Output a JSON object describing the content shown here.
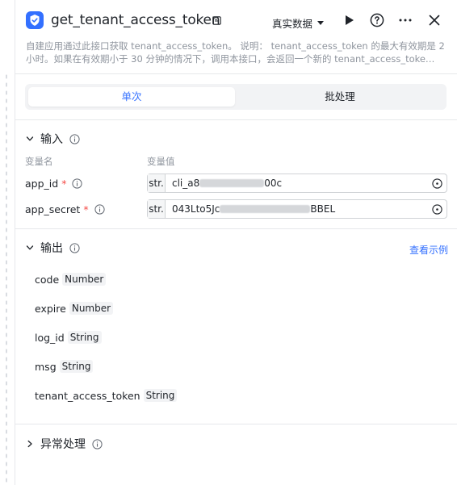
{
  "header": {
    "title": "get_tenant_access_token",
    "mode": "真实数据",
    "description_line1": "自建应用通过此接口获取 tenant_access_token。 说明： tenant_access_token 的最大有效期是 2",
    "description_line2": "小时。如果在有效期小于 30 分钟的情况下，调用本接口，会返回一个新的 tenant_access_toke…"
  },
  "tabs": [
    {
      "label": "单次",
      "active": true
    },
    {
      "label": "批处理",
      "active": false
    }
  ],
  "input": {
    "section_title": "输入",
    "col_name": "变量名",
    "col_value": "变量值",
    "params": [
      {
        "name": "app_id",
        "required_mark": "*",
        "type": "str.",
        "value_prefix": "cli_a8",
        "value_suffix": "00c"
      },
      {
        "name": "app_secret",
        "required_mark": "*",
        "type": "str.",
        "value_prefix": "043Lto5Jc",
        "value_suffix": "BBEL"
      }
    ]
  },
  "output": {
    "section_title": "输出",
    "example_link": "查看示例",
    "fields": [
      {
        "name": "code",
        "type": "Number"
      },
      {
        "name": "expire",
        "type": "Number"
      },
      {
        "name": "log_id",
        "type": "String"
      },
      {
        "name": "msg",
        "type": "String"
      },
      {
        "name": "tenant_access_token",
        "type": "String"
      }
    ]
  },
  "exception": {
    "section_title": "异常处理"
  },
  "colors": {
    "accent": "#3370ff",
    "required": "#f54a45",
    "muted": "#8f959e"
  }
}
